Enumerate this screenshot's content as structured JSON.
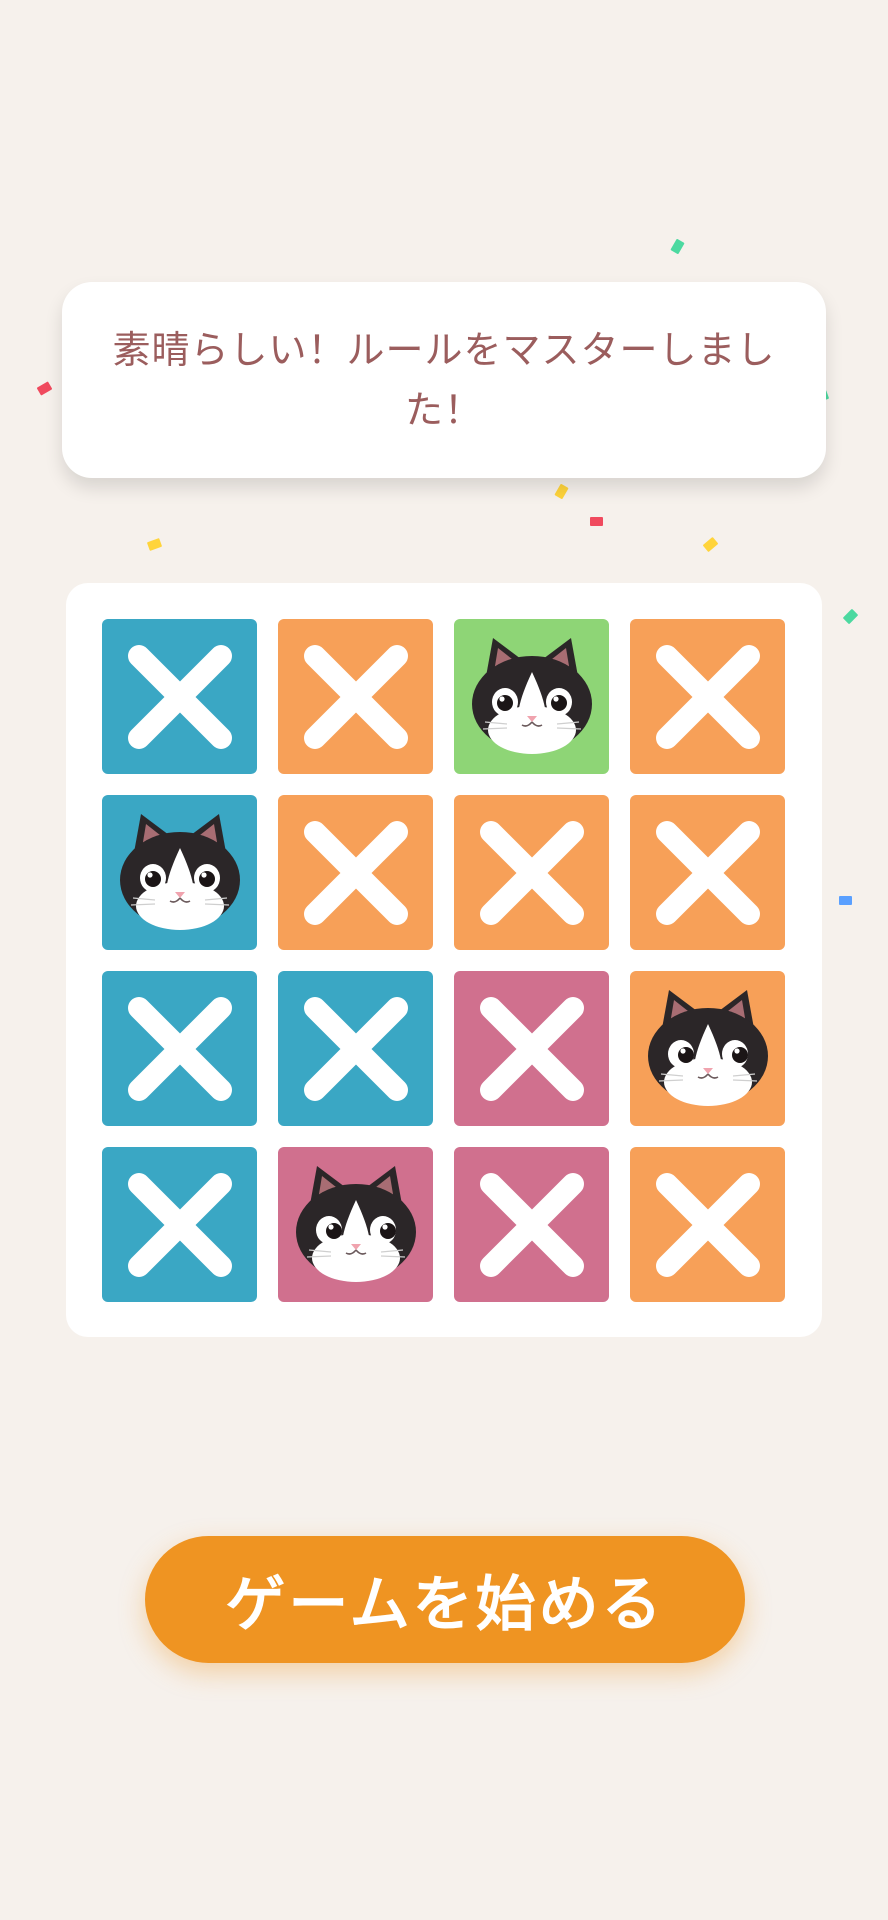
{
  "message": {
    "text": "素晴らしい！ルールをマスターしました！"
  },
  "board": {
    "tiles": [
      {
        "type": "x",
        "color": "#3aa7c4"
      },
      {
        "type": "x",
        "color": "#f7a058"
      },
      {
        "type": "cat",
        "color": "#8ed576",
        "pose": "front"
      },
      {
        "type": "x",
        "color": "#f7a058"
      },
      {
        "type": "cat",
        "color": "#3aa7c4",
        "pose": "front"
      },
      {
        "type": "x",
        "color": "#f7a058"
      },
      {
        "type": "x",
        "color": "#f7a058"
      },
      {
        "type": "x",
        "color": "#f7a058"
      },
      {
        "type": "x",
        "color": "#3aa7c4"
      },
      {
        "type": "x",
        "color": "#3aa7c4"
      },
      {
        "type": "x",
        "color": "#d0708e"
      },
      {
        "type": "cat",
        "color": "#f7a058",
        "pose": "side"
      },
      {
        "type": "x",
        "color": "#3aa7c4"
      },
      {
        "type": "cat",
        "color": "#d0708e",
        "pose": "side"
      },
      {
        "type": "x",
        "color": "#d0708e"
      },
      {
        "type": "x",
        "color": "#f7a058"
      }
    ]
  },
  "start_button": {
    "label": "ゲームを始める",
    "color": "#ef9422"
  },
  "confetti_colors": [
    "#f04a5e",
    "#ffd43b",
    "#4cd9a0",
    "#3b9cf5",
    "#5aa0ff"
  ]
}
